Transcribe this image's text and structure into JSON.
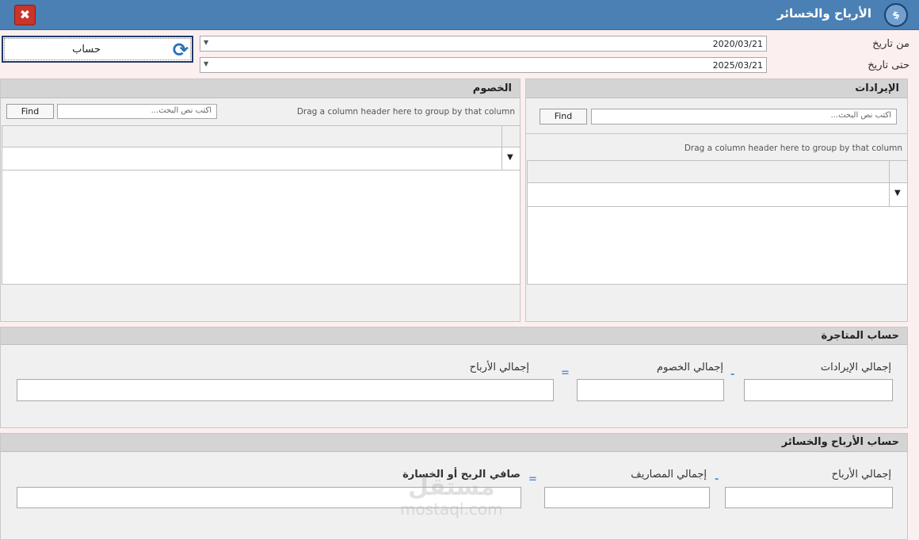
{
  "window": {
    "title": "الأرباح والخسائر",
    "close_label": "✖"
  },
  "filters": {
    "from_label": "من تاريخ",
    "from_value": "2020/03/21",
    "to_label": "حتى تاريخ",
    "to_value": "2025/03/21",
    "calc_label": "حساب"
  },
  "revenues": {
    "title": "الإيرادات",
    "find": "Find",
    "search_placeholder": "اكتب نص البحث...",
    "drag_hint": "Drag a column header here to group by that column"
  },
  "liabilities": {
    "title": "الخصوم",
    "find": "Find",
    "search_placeholder": "اكتب نص البحث...",
    "drag_hint": "Drag a column header here to group by that column"
  },
  "trading": {
    "title": "حساب المتاجرة",
    "total_revenues": "إجمالي الإيرادات",
    "minus": "-",
    "total_liabilities": "إجمالي الخصوم",
    "equals": "=",
    "total_profits": "إجمالي الأرباح"
  },
  "pnl": {
    "title": "حساب  الأرباح والخسائر",
    "total_profits": "إجمالي الأرباح",
    "minus": "-",
    "total_expenses": "إجمالي المصاريف",
    "equals": "=",
    "net": "صافي الربح أو الخسارة"
  },
  "watermark": {
    "logo": "مستقل",
    "url": "mostaql.com"
  }
}
